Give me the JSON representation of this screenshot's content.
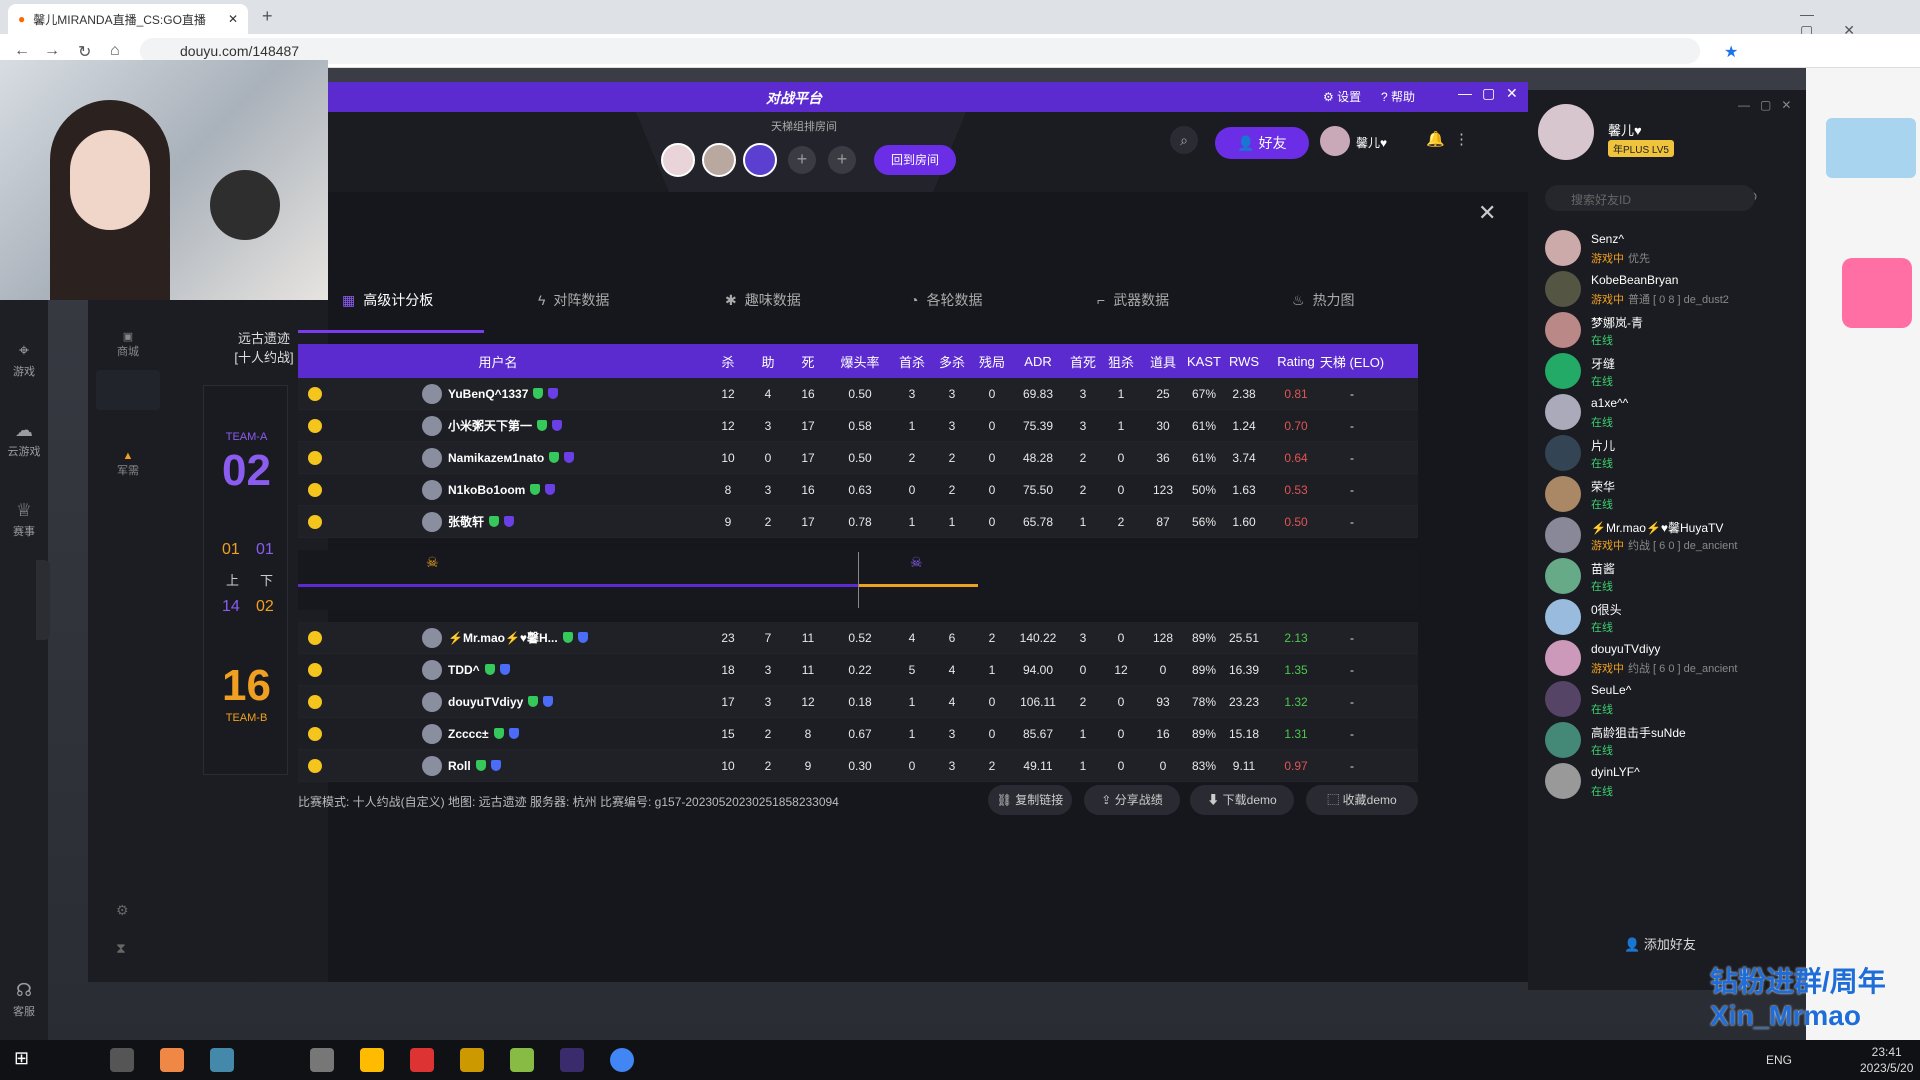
{
  "browser": {
    "tab_title": "馨儿MIRANDA直播_CS:GO直播",
    "url": "douyu.com/148487"
  },
  "left_rail": [
    {
      "icon": "gamepad-icon",
      "label": "游戏"
    },
    {
      "icon": "cloud-game-icon",
      "label": "云游戏"
    },
    {
      "icon": "trophy-icon",
      "label": "赛事"
    },
    {
      "icon": "headset-icon",
      "label": "客服"
    }
  ],
  "app": {
    "title_logo": "对战平台",
    "settings": "设置",
    "help": "帮助",
    "room_label": "天梯组排房间",
    "back_room": "回到房间",
    "friends": "好友",
    "user_name": "馨儿♥",
    "side_labels": [
      "商城",
      "军需"
    ]
  },
  "match": {
    "map": "远古遗迹",
    "mode_label": "[十人约战]",
    "team_a_label": "TEAM-A",
    "team_a_score": "02",
    "team_b_label": "TEAM-B",
    "team_b_score": "16",
    "half_a": [
      "01",
      "14"
    ],
    "half_b": [
      "01",
      "02"
    ],
    "half_labels": [
      "上",
      "下"
    ]
  },
  "tabs": [
    "高级计分板",
    "对阵数据",
    "趣味数据",
    "各轮数据",
    "武器数据",
    "热力图"
  ],
  "headers": [
    "用户名",
    "杀",
    "助",
    "死",
    "爆头率",
    "首杀",
    "多杀",
    "残局",
    "ADR",
    "首死",
    "狙杀",
    "道具",
    "KAST",
    "RWS",
    "Rating",
    "天梯 (ELO)"
  ],
  "team_a": [
    [
      "YuBenQ^1337",
      "12",
      "4",
      "16",
      "0.50",
      "3",
      "3",
      "0",
      "69.83",
      "3",
      "1",
      "25",
      "67%",
      "2.38",
      "0.81",
      "-"
    ],
    [
      "小米粥天下第一",
      "12",
      "3",
      "17",
      "0.58",
      "1",
      "3",
      "0",
      "75.39",
      "3",
      "1",
      "30",
      "61%",
      "1.24",
      "0.70",
      "-"
    ],
    [
      "Namikazeм1nato",
      "10",
      "0",
      "17",
      "0.50",
      "2",
      "2",
      "0",
      "48.28",
      "2",
      "0",
      "36",
      "61%",
      "3.74",
      "0.64",
      "-"
    ],
    [
      "N1koBo1oom",
      "8",
      "3",
      "16",
      "0.63",
      "0",
      "2",
      "0",
      "75.50",
      "2",
      "0",
      "123",
      "50%",
      "1.63",
      "0.53",
      "-"
    ],
    [
      "张敬轩",
      "9",
      "2",
      "17",
      "0.78",
      "1",
      "1",
      "0",
      "65.78",
      "1",
      "2",
      "87",
      "56%",
      "1.60",
      "0.50",
      "-"
    ]
  ],
  "team_b": [
    [
      "⚡Mr.mao⚡♥馨H...",
      "23",
      "7",
      "11",
      "0.52",
      "4",
      "6",
      "2",
      "140.22",
      "3",
      "0",
      "128",
      "89%",
      "25.51",
      "2.13",
      "-"
    ],
    [
      "TDD^",
      "18",
      "3",
      "11",
      "0.22",
      "5",
      "4",
      "1",
      "94.00",
      "0",
      "12",
      "0",
      "89%",
      "16.39",
      "1.35",
      "-"
    ],
    [
      "douyuTVdiyy",
      "17",
      "3",
      "12",
      "0.18",
      "1",
      "4",
      "0",
      "106.11",
      "2",
      "0",
      "93",
      "78%",
      "23.23",
      "1.32",
      "-"
    ],
    [
      "Zcccc±",
      "15",
      "2",
      "8",
      "0.67",
      "1",
      "3",
      "0",
      "85.67",
      "1",
      "0",
      "16",
      "89%",
      "15.18",
      "1.31",
      "-"
    ],
    [
      "Roll",
      "10",
      "2",
      "9",
      "0.30",
      "0",
      "3",
      "2",
      "49.11",
      "1",
      "0",
      "0",
      "83%",
      "9.11",
      "0.97",
      "-"
    ]
  ],
  "footer": {
    "info": "比赛模式: 十人约战(自定义) 地图: 远古遗迹 服务器: 杭州 比赛编号: g157-20230520230251858233094",
    "copy_link": "复制链接",
    "share": "分享战绩",
    "download": "下载demo",
    "collect": "收藏demo"
  },
  "friends_panel": {
    "user": "馨儿♥",
    "badge": "年PLUS LV5",
    "search_placeholder": "搜索好友ID",
    "add_friend": "添加好友",
    "friends": [
      {
        "name": "Senz^",
        "status": "游戏中",
        "extra": "优先"
      },
      {
        "name": "KobeBeanBryan",
        "status": "游戏中",
        "extra": "普通 [ 0 8 ] de_dust2"
      },
      {
        "name": "梦娜岚-青",
        "status": "在线",
        "extra": ""
      },
      {
        "name": "牙缝",
        "status": "在线",
        "extra": ""
      },
      {
        "name": "a1xe^^",
        "status": "在线",
        "extra": ""
      },
      {
        "name": "片儿",
        "status": "在线",
        "extra": ""
      },
      {
        "name": "荣华",
        "status": "在线",
        "extra": ""
      },
      {
        "name": "⚡Mr.mao⚡♥馨HuyaTV",
        "status": "游戏中",
        "extra": "约战 [ 6 0 ] de_ancient"
      },
      {
        "name": "苗酱",
        "status": "在线",
        "extra": ""
      },
      {
        "name": "0很头",
        "status": "在线",
        "extra": ""
      },
      {
        "name": "douyuTVdiyy",
        "status": "游戏中",
        "extra": "约战 [ 6 0 ] de_ancient"
      },
      {
        "name": "SeuLe^",
        "status": "在线",
        "extra": ""
      },
      {
        "name": "高龄狙击手suNde",
        "status": "在线",
        "extra": ""
      },
      {
        "name": "dyinLYF^",
        "status": "在线",
        "extra": ""
      }
    ]
  },
  "overlay": {
    "line1": "钻粉进群/周年",
    "line2": "Xin_Mrmao"
  },
  "taskbar": {
    "time": "23:41",
    "date": "2023/5/20",
    "lang": "ENG"
  },
  "colors": {
    "accent": "#5b2bd0",
    "win": "#4cc94a",
    "loss": "#e05454"
  }
}
